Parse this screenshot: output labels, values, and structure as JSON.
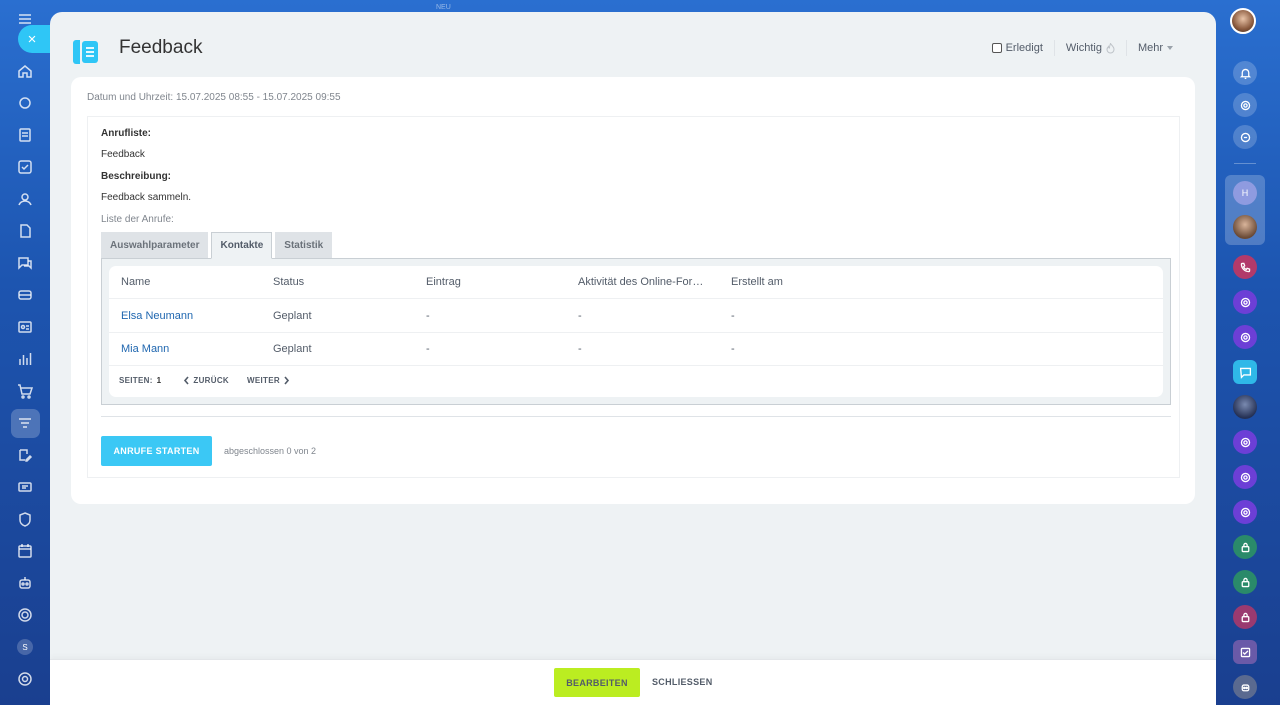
{
  "top_hint": "NEU",
  "window": {
    "title": "Feedback",
    "actions": {
      "done_label": "Erledigt",
      "important_label": "Wichtig",
      "more_label": "Mehr"
    }
  },
  "activity": {
    "datetime_label": "Datum und Uhrzeit:",
    "datetime_value": "15.07.2025 08:55 - 15.07.2025 09:55",
    "call_list_label": "Anrufliste:",
    "call_list_value": "Feedback",
    "description_label": "Beschreibung:",
    "description_value": "Feedback sammeln.",
    "calls_list_label": "Liste der Anrufe:"
  },
  "tabs": [
    {
      "label": "Auswahlparameter",
      "active": false
    },
    {
      "label": "Kontakte",
      "active": true
    },
    {
      "label": "Statistik",
      "active": false
    }
  ],
  "table": {
    "columns": [
      "Name",
      "Status",
      "Eintrag",
      "Aktivität des Online-Formulars",
      "Erstellt am"
    ],
    "rows": [
      {
        "name": "Elsa Neumann",
        "status": "Geplant",
        "entry": "-",
        "online_form": "-",
        "created": "-"
      },
      {
        "name": "Mia Mann",
        "status": "Geplant",
        "entry": "-",
        "online_form": "-",
        "created": "-"
      }
    ],
    "pager": {
      "pages_label": "SEITEN:",
      "page": "1",
      "prev_label": "ZURÜCK",
      "next_label": "WEITER"
    }
  },
  "start_button_label": "ANRUFE STARTEN",
  "progress_text": "abgeschlossen 0 von 2",
  "footer": {
    "edit_label": "BEARBEITEN",
    "close_label": "SCHLIESSEN"
  },
  "left_sidebar": {
    "close_icon": "×",
    "user_initial": "S"
  },
  "right_sidebar": {
    "group_initial": "H"
  },
  "colors": {
    "accent_blue": "#2fc6f6",
    "edit_green": "#bbed21",
    "link_blue": "#2067b0",
    "sidebar_blue": "#1d55b0"
  }
}
